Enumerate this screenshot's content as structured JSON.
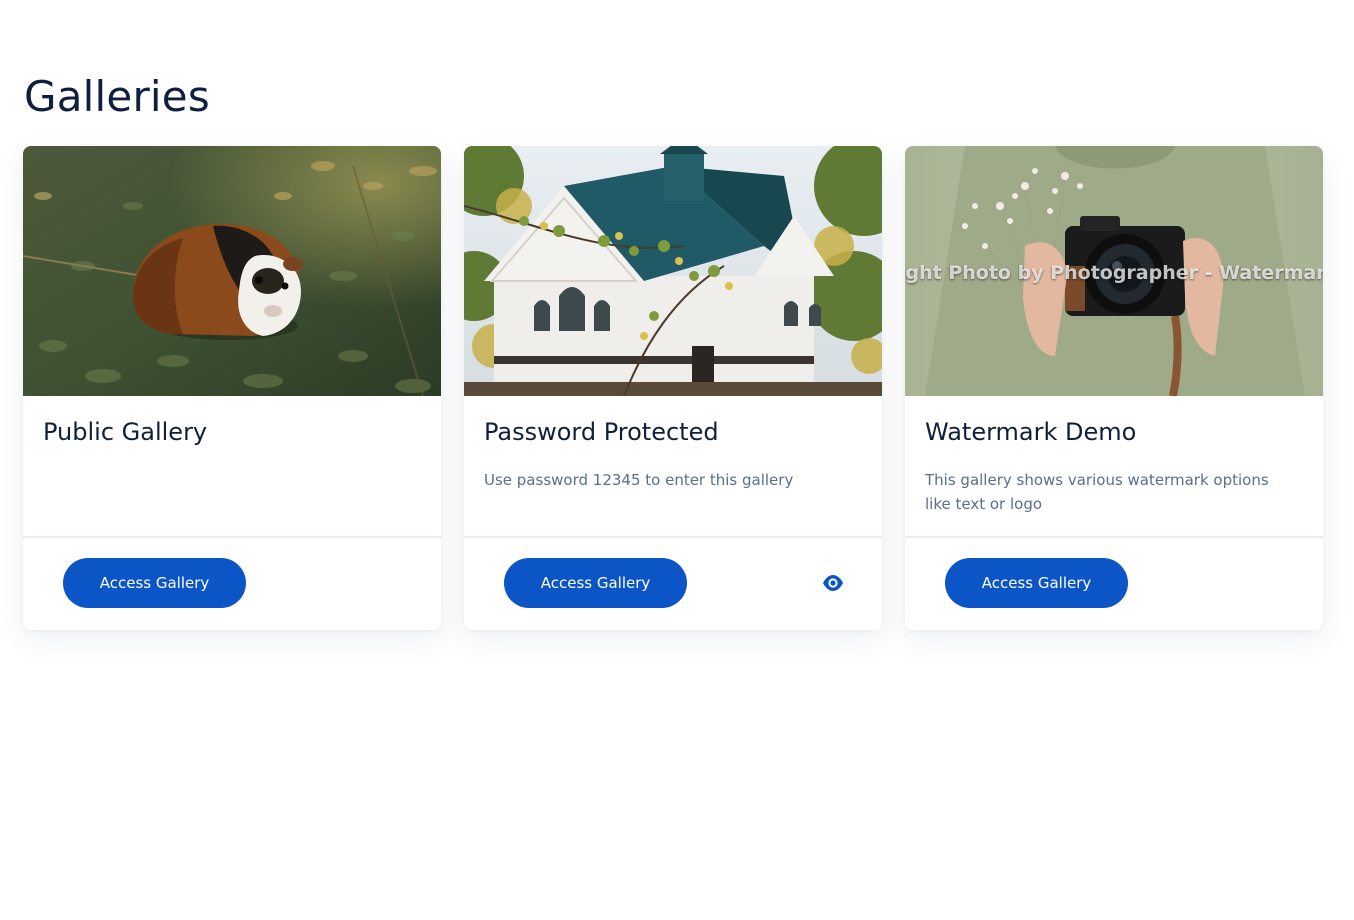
{
  "page": {
    "title": "Galleries"
  },
  "galleries": [
    {
      "title": "Public Gallery",
      "description": "",
      "button_label": "Access Gallery",
      "image_subject": "guinea pig on grass"
    },
    {
      "title": "Password Protected",
      "description": "Use password 12345 to enter this gallery",
      "button_label": "Access Gallery",
      "image_subject": "white church with green roof under autumn trees",
      "has_preview_icon": true,
      "preview_icon": "eye-icon"
    },
    {
      "title": "Watermark Demo",
      "description": "This gallery shows various watermark options like text or logo",
      "button_label": "Access Gallery",
      "image_subject": "person in green hoodie holding camera and dried flowers",
      "watermark_text": "ight Photo by Photographer - Watermar"
    }
  ],
  "colors": {
    "primary_button": "#0b55c6",
    "heading": "#0e1f3f",
    "body_text": "#5c6e8a",
    "divider": "#e9edf3"
  }
}
